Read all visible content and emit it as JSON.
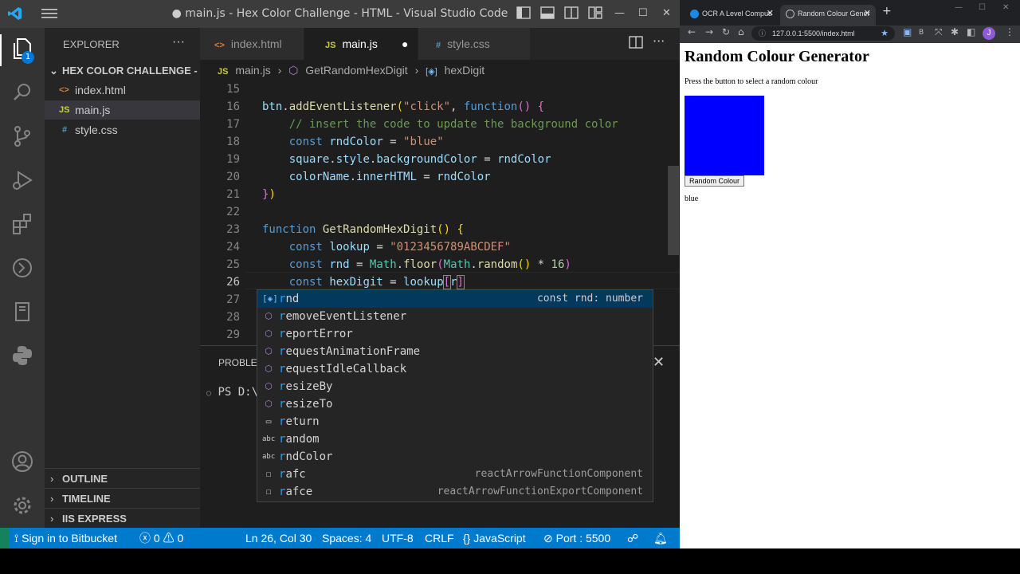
{
  "vscode": {
    "window_title": "● main.js - Hex Color Challenge - HTML - Visual Studio Code",
    "explorer_title": "EXPLORER",
    "folder_name": "HEX COLOR CHALLENGE - ...",
    "files": [
      {
        "name": "index.html",
        "icon": "<>"
      },
      {
        "name": "main.js",
        "icon": "JS"
      },
      {
        "name": "style.css",
        "icon": "#"
      }
    ],
    "explorer_badge": "1",
    "sections": [
      "OUTLINE",
      "TIMELINE",
      "IIS EXPRESS"
    ],
    "tabs": [
      {
        "label": "index.html",
        "icon": "<>"
      },
      {
        "label": "main.js",
        "icon": "JS"
      },
      {
        "label": "style.css",
        "icon": "#"
      }
    ],
    "breadcrumb": [
      "main.js",
      "GetRandomHexDigit",
      "hexDigit"
    ],
    "line_numbers": [
      "15",
      "16",
      "17",
      "18",
      "19",
      "20",
      "21",
      "22",
      "23",
      "24",
      "25",
      "26",
      "27",
      "28",
      "29"
    ],
    "panel_tab": "PROBLEM",
    "terminal_text": "PS D:\\",
    "suggestions": [
      {
        "label": "rnd",
        "icon": "var",
        "detail": "const rnd: number"
      },
      {
        "label": "removeEventListener",
        "icon": "cube",
        "detail": ""
      },
      {
        "label": "reportError",
        "icon": "cube",
        "detail": ""
      },
      {
        "label": "requestAnimationFrame",
        "icon": "cube",
        "detail": ""
      },
      {
        "label": "requestIdleCallback",
        "icon": "cube",
        "detail": ""
      },
      {
        "label": "resizeBy",
        "icon": "cube",
        "detail": ""
      },
      {
        "label": "resizeTo",
        "icon": "cube",
        "detail": ""
      },
      {
        "label": "return",
        "icon": "keyword",
        "detail": ""
      },
      {
        "label": "random",
        "icon": "abc",
        "detail": ""
      },
      {
        "label": "rndColor",
        "icon": "abc",
        "detail": ""
      },
      {
        "label": "rafc",
        "icon": "snippet",
        "detail": "reactArrowFunctionComponent"
      },
      {
        "label": "rafce",
        "icon": "snippet",
        "detail": "reactArrowFunctionExportComponent"
      }
    ],
    "status": {
      "bitbucket": "Sign in to Bitbucket",
      "errors": "0",
      "warnings": "0",
      "position": "Ln 26, Col 30",
      "spaces": "Spaces: 4",
      "encoding": "UTF-8",
      "eol": "CRLF",
      "language": "JavaScript",
      "port": "Port : 5500"
    }
  },
  "browser": {
    "tabs": [
      "OCR A Level Computi",
      "Random Colour Gener"
    ],
    "url": "127.0.0.1:5500/index.html",
    "profile_initial": "J",
    "page_heading": "Random Colour Generator",
    "page_text": "Press the button to select a random colour",
    "button_label": "Random Colour",
    "color_name": "blue",
    "square_color": "#0000ff"
  },
  "colors": {
    "status_bar": "#007acc",
    "activity_bar": "#333333",
    "sidebar": "#252526",
    "editor_bg": "#1e1e1e"
  }
}
